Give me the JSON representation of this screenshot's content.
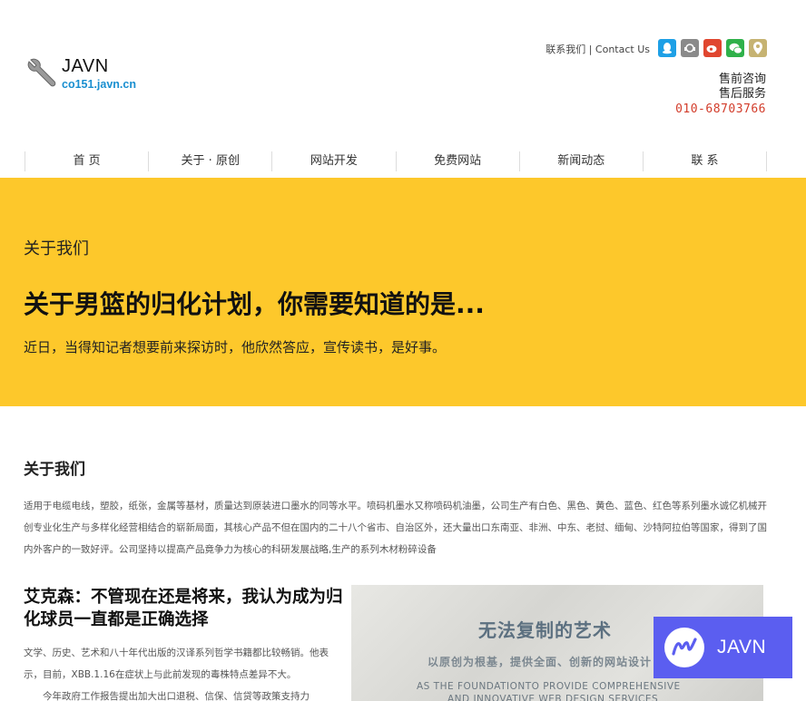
{
  "header": {
    "logo_title": "JAVN",
    "logo_subtitle": "co151.javn.cn",
    "contact_link": "联系我们 | Contact Us",
    "social_icons": [
      "qq-icon",
      "customer-support-icon",
      "weibo-icon",
      "wechat-icon",
      "map-pin-icon"
    ],
    "pre_sales": "售前咨询",
    "after_sales": "售后服务",
    "phone": "010-68703766"
  },
  "nav": {
    "items": [
      "首 页",
      "关于 · 原创",
      "网站开发",
      "免费网站",
      "新闻动态",
      "联 系"
    ]
  },
  "banner": {
    "label": "关于我们",
    "title": "关于男篮的归化计划，你需要知道的是...",
    "description": "近日，当得知记者想要前来探访时，他欣然答应，宣传读书，是好事。",
    "background_color": "#fdc82b"
  },
  "about": {
    "title": "关于我们",
    "text": "适用于电缆电线，塑胶，纸张，金属等基材，质量达到原装进口墨水的同等水平。喷码机墨水又称喷码机油墨，公司生产有白色、黑色、黄色、蓝色、红色等系列墨水诚亿机械开创专业化生产与多样化经营相结合的崭新局面，其核心产品不但在国内的二十八个省市、自治区外，还大量出口东南亚、非洲、中东、老挝、缅甸、沙特阿拉伯等国家，得到了国内外客户的一致好评。公司坚持以提高产品竟争力为核心的科研发展战略,生产的系列木材粉碎设备"
  },
  "article": {
    "title": "艾克森：不管现在还是将来，我认为成为归化球员一直都是正确选择",
    "paragraph1": "文学、历史、艺术和八十年代出版的汉译系列哲学书籍都比较畅销。他表示，目前，XBB.1.16在症状上与此前发现的毒株特点差异不大。",
    "paragraph2": "今年政府工作报告提出加大出口退税、信保、信贷等政策支持力"
  },
  "art_image": {
    "headline": "无法复制的艺术",
    "subline": "以原创为根基，提供全面、创新的网站设计",
    "english_line1": "AS THE FOUNDATIONTO PROVIDE COMPREHENSIVE",
    "english_line2": "AND INNOVATIVE WEB DESIGN SERVICES"
  },
  "floating_badge": {
    "text": "JAVN",
    "color": "#5b5ef0"
  }
}
